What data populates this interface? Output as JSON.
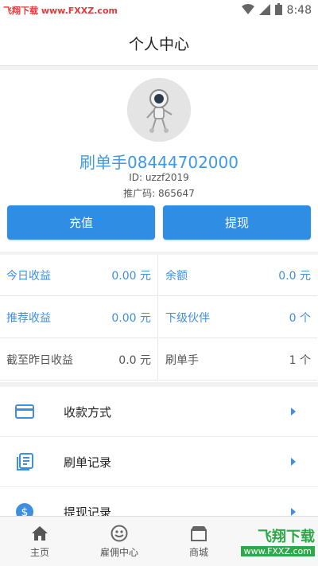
{
  "status_bar": {
    "watermark": "飞翔下载 www.FXXZ.com",
    "time": "8:48"
  },
  "header": {
    "title": "个人中心"
  },
  "profile": {
    "username": "刷单手08444702000",
    "id_text": "ID: uzzf2019",
    "promo_text": "推广码: 865647",
    "recharge_label": "充值",
    "withdraw_label": "提现"
  },
  "stats": {
    "today_income": {
      "label": "今日收益",
      "value": "0.00 元"
    },
    "balance": {
      "label": "余额",
      "value": "0.0 元"
    },
    "referral_income": {
      "label": "推荐收益",
      "value": "0.00 元"
    },
    "sub_partners": {
      "label": "下级伙伴",
      "value": "0 个"
    },
    "yesterday_income": {
      "label": "截至昨日收益",
      "value": "0.0 元"
    },
    "order_brusher": {
      "label": "刷单手",
      "value": "1 个"
    }
  },
  "menu": {
    "items": [
      {
        "label": "收款方式",
        "icon": "card-icon"
      },
      {
        "label": "刷单记录",
        "icon": "list-icon"
      },
      {
        "label": "提现记录",
        "icon": "dollar-icon"
      }
    ]
  },
  "bottom_nav": {
    "items": [
      {
        "label": "主页",
        "icon": "home-icon"
      },
      {
        "label": "雇佣中心",
        "icon": "face-icon"
      },
      {
        "label": "商城",
        "icon": "shop-icon"
      }
    ]
  },
  "watermark_bottom": {
    "main": "飞翔下载",
    "sub": "www.FXXZ.com"
  },
  "colors": {
    "accent": "#2f8de4",
    "accent_text": "#3f8fdf",
    "watermark_green": "#2fa84a"
  }
}
